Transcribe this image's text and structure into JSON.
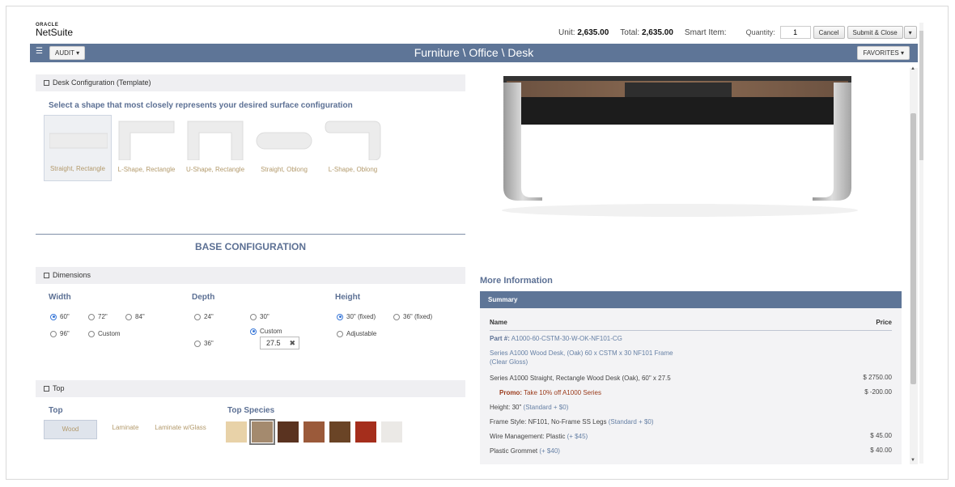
{
  "header": {
    "logo_top": "ORACLE",
    "logo_main": "NetSuite",
    "unit_label": "Unit:",
    "unit_value": "2,635.00",
    "total_label": "Total:",
    "total_value": "2,635.00",
    "smart_item_label": "Smart Item:",
    "quantity_label": "Quantity:",
    "quantity_value": "1",
    "cancel_label": "Cancel",
    "submit_label": "Submit & Close",
    "dropdown_label": "▾"
  },
  "navbar": {
    "menu_icon": "☰",
    "audit_label": "AUDIT ▾",
    "title": "Furniture \\ Office \\ Desk",
    "favorites_label": "FAVORITES ▾"
  },
  "desk_config": {
    "section_label": "Desk Configuration (Template)",
    "prompt": "Select a shape that most closely represents your desired surface configuration",
    "shapes": [
      {
        "label": "Straight, Rectangle",
        "selected": true
      },
      {
        "label": "L-Shape, Rectangle",
        "selected": false
      },
      {
        "label": "U-Shape, Rectangle",
        "selected": false
      },
      {
        "label": "Straight, Oblong",
        "selected": false
      },
      {
        "label": "L-Shape, Oblong",
        "selected": false
      }
    ]
  },
  "base": {
    "title": "BASE CONFIGURATION",
    "dimensions_label": "Dimensions",
    "width": {
      "title": "Width",
      "options": [
        "60\"",
        "72\"",
        "84\"",
        "96\"",
        "Custom"
      ],
      "selected": "60\""
    },
    "depth": {
      "title": "Depth",
      "options": [
        "24\"",
        "30\"",
        "36\"",
        "Custom"
      ],
      "selected": "Custom",
      "custom_value": "27.5"
    },
    "height": {
      "title": "Height",
      "options": [
        "30\" (fixed)",
        "36\" (fixed)",
        "Adjustable"
      ],
      "selected": "30\" (fixed)"
    },
    "clear_icon": "✖"
  },
  "top": {
    "section_label": "Top",
    "title": "Top",
    "options": [
      "Wood",
      "Laminate",
      "Laminate w/Glass"
    ],
    "selected": "Wood",
    "species_title": "Top Species",
    "swatches": [
      "#e8d2a8",
      "#a48a6e",
      "#5a3320",
      "#9b5a3a",
      "#6a4426",
      "#a52e1c",
      "#ebe9e6"
    ],
    "selected_swatch": 1
  },
  "more_info": {
    "title": "More Information",
    "summary_label": "Summary",
    "name_header": "Name",
    "price_header": "Price",
    "part_label": "Part #:",
    "part_value": "A1000-60-CSTM-30-W-OK-NF101-CG",
    "desc_line1": "Series A1000 Wood Desk, (Oak) 60 x CSTM x 30 NF101 Frame",
    "desc_line2": "(Clear Gloss)",
    "item_line": "Series A1000 Straight, Rectangle Wood Desk (Oak), 60\" x 27.5",
    "item_price": "$ 2750.00",
    "promo_label": "Promo:",
    "promo_text": "Take 10% off A1000 Series",
    "promo_price": "$ -200.00",
    "height_text": "Height: 30\"",
    "height_note": "(Standard + $0)",
    "frame_text": "Frame Style: NF101, No-Frame SS Legs",
    "frame_note": "(Standard + $0)",
    "wire_text": "Wire Management: Plastic",
    "wire_note": "(+ $45)",
    "wire_price": "$ 45.00",
    "grommet_text": "Plastic Grommet",
    "grommet_note": "(+ $40)",
    "grommet_price": "$ 40.00"
  }
}
